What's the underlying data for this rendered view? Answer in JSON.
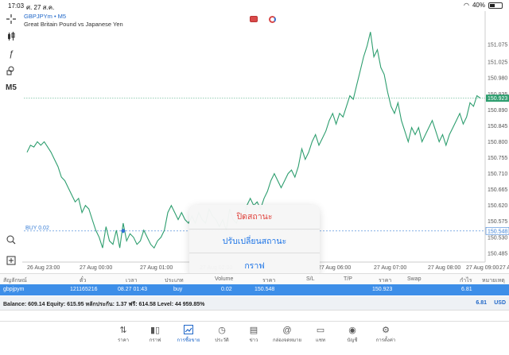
{
  "status_bar": {
    "time": "17:03",
    "date": "ศ. 27 ส.ค.",
    "battery": "40%",
    "battery_level": 0.4
  },
  "symbol": {
    "code": "GBPJPYm",
    "separator": "•",
    "timeframe": "M5",
    "description": "Great Britain Pound vs Japanese Yen"
  },
  "left_toolbar": {
    "crosshair_icon": "crosshair-icon",
    "candles_icon": "candles-icon",
    "indicator_icon": "f-icon",
    "objects_icon": "shapes-icon",
    "timeframe_label": "M5",
    "zoom_icon": "zoom-icon",
    "add_icon": "add-icon"
  },
  "price_axis": [
    "151.075",
    "151.025",
    "150.980",
    "150.935",
    "150.890",
    "150.845",
    "150.800",
    "150.755",
    "150.710",
    "150.665",
    "150.620",
    "150.575",
    "150.530",
    "150.485"
  ],
  "current_price_tag": "150.923",
  "buy_line": {
    "label": "BUY 0.02",
    "price_tag": "150.548"
  },
  "time_axis": [
    "26 Aug 23:00",
    "27 Aug 00:00",
    "27 Aug 01:00",
    "27 Aug 02:00",
    "27 Aug 06:00",
    "27 Aug 07:00",
    "27 Aug 08:00",
    "27 Aug 09:00",
    "27 Aug 10:00"
  ],
  "chart_data": {
    "type": "line",
    "series": [
      {
        "values": [
          150.77,
          150.79,
          150.785,
          150.8,
          150.79,
          150.8,
          150.785,
          150.77,
          150.75,
          150.73,
          150.7,
          150.69,
          150.67,
          150.65,
          150.63,
          150.64,
          150.6,
          150.62,
          150.61,
          150.58,
          150.55,
          150.53,
          150.5,
          150.56,
          150.52,
          150.51,
          150.55,
          150.5,
          150.57,
          150.52,
          150.54,
          150.53,
          150.51,
          150.52,
          150.55,
          150.53,
          150.51,
          150.5,
          150.52,
          150.53,
          150.55,
          150.6,
          150.62,
          150.6,
          150.58,
          150.6,
          150.58,
          150.57,
          150.59,
          150.57,
          150.6,
          150.58,
          150.57,
          150.61,
          150.59,
          150.58,
          150.56,
          150.58,
          150.55,
          150.61,
          150.58,
          150.57,
          150.6,
          150.58,
          150.62,
          150.64,
          150.62,
          150.63,
          150.61,
          150.64,
          150.66,
          150.69,
          150.71,
          150.69,
          150.67,
          150.69,
          150.71,
          150.72,
          150.7,
          150.73,
          150.78,
          150.75,
          150.77,
          150.8,
          150.82,
          150.79,
          150.81,
          150.83,
          150.86,
          150.88,
          150.85,
          150.88,
          150.87,
          150.9,
          150.93,
          150.92,
          150.96,
          151.0,
          151.04,
          151.07,
          151.11,
          151.04,
          151.06,
          151.01,
          150.99,
          150.94,
          150.9,
          150.88,
          150.91,
          150.86,
          150.83,
          150.8,
          150.84,
          150.82,
          150.84,
          150.8,
          150.82,
          150.84,
          150.86,
          150.83,
          150.8,
          150.82,
          150.79,
          150.82,
          150.84,
          150.86,
          150.88,
          150.85,
          150.87,
          150.91,
          150.9,
          150.93,
          150.923
        ]
      }
    ],
    "xlabel": "",
    "ylabel": "",
    "ylim": [
      150.46,
      151.16
    ],
    "current_price": 150.923,
    "buy_price": 150.548,
    "buy_marker": {
      "index": 28,
      "price": 150.548
    },
    "line_color": "#2e9e6f",
    "dashed_line_color": "#2e9e6f"
  },
  "popup": {
    "close_position": "ปิดสถานะ",
    "modify_position": "ปรับเปลี่ยนสถานะ",
    "chart": "กราฟ"
  },
  "table": {
    "headers": [
      "สัญลักษณ์",
      "ตั๋ว",
      "เวลา",
      "ประเภท",
      "Volume",
      "ราคา",
      "S/L",
      "T/P",
      "ราคา",
      "Swap",
      "กำไร",
      "หมายเหตุ"
    ],
    "row": {
      "symbol": "gbpjpym",
      "ticket": "121165216",
      "time": "08.27 01:43",
      "type": "buy",
      "volume": "0.02",
      "open_price": "150.548",
      "current_price": "150.923",
      "profit": "6.81"
    }
  },
  "balance": {
    "text": "Balance: 609.14 Equity: 615.95 หลักประกัน: 1.37 ฟรี: 614.58 Level: 44 959.85%",
    "total": "6.81",
    "currency": "USD"
  },
  "bottom_nav": [
    {
      "label": "ราคา",
      "icon": "arrows-icon"
    },
    {
      "label": "กราฟ",
      "icon": "candles-icon"
    },
    {
      "label": "การซื้อขาย",
      "icon": "trade-icon",
      "active": true
    },
    {
      "label": "ประวัติ",
      "icon": "history-icon"
    },
    {
      "label": "ข่าว",
      "icon": "news-icon"
    },
    {
      "label": "กล่องจดหมาย",
      "icon": "mail-icon"
    },
    {
      "label": "แชท",
      "icon": "chat-icon"
    },
    {
      "label": "บัญชี",
      "icon": "account-icon"
    },
    {
      "label": "การตั้งค่า",
      "icon": "settings-icon"
    }
  ],
  "colors": {
    "accent": "#1e66c8",
    "chart_line": "#2e9e6f",
    "close_red": "#e0403a",
    "selected_row": "#3d8ee8"
  }
}
